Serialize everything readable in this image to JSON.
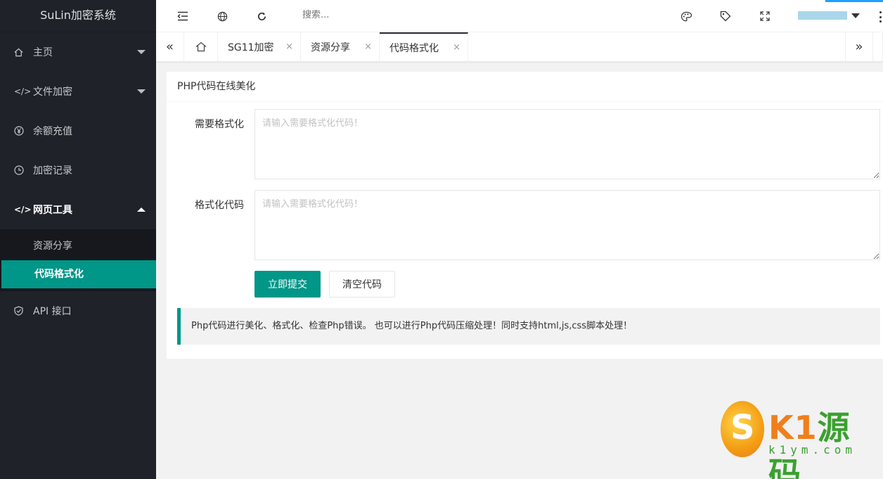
{
  "app": {
    "logo": "SuLin加密系统"
  },
  "sidebar": {
    "items": [
      {
        "label": "主页",
        "icon": "home-icon",
        "expanded": false
      },
      {
        "label": "文件加密",
        "icon": "code-icon",
        "expanded": false
      },
      {
        "label": "余额充值",
        "icon": "yen-icon",
        "expanded": false
      },
      {
        "label": "加密记录",
        "icon": "clock-icon",
        "expanded": false
      },
      {
        "label": "网页工具",
        "icon": "code-icon",
        "expanded": true
      },
      {
        "label": "API 接口",
        "icon": "shield-icon",
        "expanded": false
      }
    ],
    "subitems": [
      {
        "label": "资源分享",
        "active": false
      },
      {
        "label": "代码格式化",
        "active": true
      }
    ]
  },
  "header": {
    "search_placeholder": "搜索...",
    "icons": [
      "menu-toggle-icon",
      "globe-icon",
      "refresh-icon",
      "palette-icon",
      "tag-icon",
      "fullscreen-icon",
      "more-icon"
    ]
  },
  "tabs": {
    "items": [
      {
        "label": "SG11加密",
        "close": "×"
      },
      {
        "label": "资源分享",
        "close": "×"
      },
      {
        "label": "代码格式化",
        "close": "×",
        "active": true
      }
    ],
    "prev": "«",
    "next": "»"
  },
  "card": {
    "title": "PHP代码在线美化",
    "input_label": "需要格式化",
    "input_placeholder": "请输入需要格式化代码！",
    "output_label": "格式化代码",
    "output_placeholder": "请输入需要格式化代码！",
    "submit_label": "立即提交",
    "clear_label": "清空代码",
    "note": "Php代码进行美化、格式化、检查Php错误。 也可以进行Php代码压缩处理！同时支持html,js,css脚本处理！"
  },
  "watermark": {
    "title": "K1",
    "title_cn": "源码",
    "sub": "k1ym.com"
  },
  "colors": {
    "accent": "#009688",
    "sidebar_bg": "#20222a"
  }
}
